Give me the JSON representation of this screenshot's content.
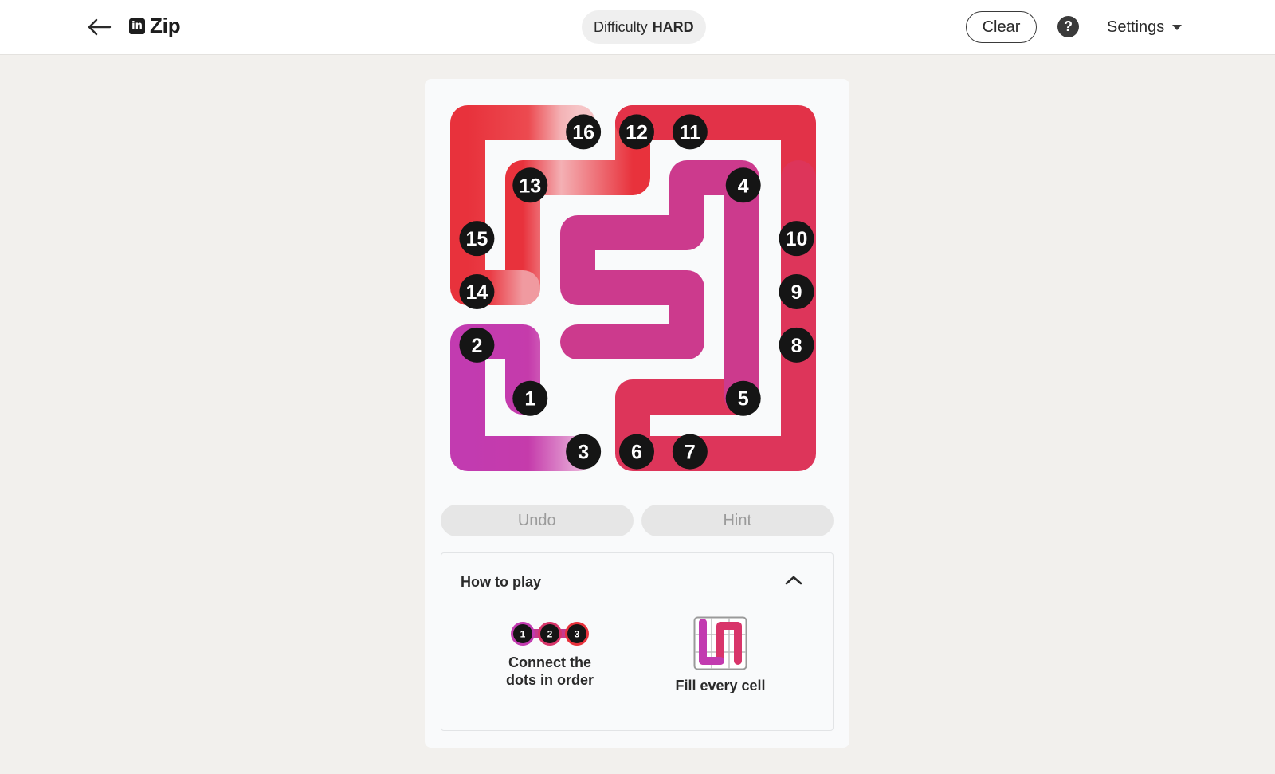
{
  "header": {
    "title": "Zip",
    "logo": "in",
    "difficulty_label": "Difficulty",
    "difficulty_value": "HARD",
    "clear_label": "Clear",
    "help_label": "?",
    "settings_label": "Settings",
    "icons": [
      "back-arrow-icon",
      "linkedin-logo-icon",
      "help-icon",
      "chevron-down-icon"
    ]
  },
  "board": {
    "grid_size": 7,
    "colors": {
      "red": "#e8323c",
      "pink_light": "#f2a8ad",
      "crimson": "#de3559",
      "magenta": "#cf3a84",
      "purple": "#c23bb0",
      "lilac": "#d87fc0",
      "node": "#151515"
    },
    "nodes": [
      {
        "label": "1",
        "row": 5,
        "col": 1
      },
      {
        "label": "2",
        "row": 4,
        "col": 0
      },
      {
        "label": "3",
        "row": 6,
        "col": 2
      },
      {
        "label": "4",
        "row": 1,
        "col": 5
      },
      {
        "label": "5",
        "row": 5,
        "col": 5
      },
      {
        "label": "6",
        "row": 6,
        "col": 3
      },
      {
        "label": "7",
        "row": 6,
        "col": 4
      },
      {
        "label": "8",
        "row": 4,
        "col": 6
      },
      {
        "label": "9",
        "row": 3,
        "col": 6
      },
      {
        "label": "10",
        "row": 2,
        "col": 6
      },
      {
        "label": "11",
        "row": 0,
        "col": 4
      },
      {
        "label": "12",
        "row": 0,
        "col": 3
      },
      {
        "label": "13",
        "row": 1,
        "col": 1
      },
      {
        "label": "14",
        "row": 3,
        "col": 0
      },
      {
        "label": "15",
        "row": 2,
        "col": 0
      },
      {
        "label": "16",
        "row": 0,
        "col": 2
      }
    ]
  },
  "actions": {
    "undo_label": "Undo",
    "hint_label": "Hint"
  },
  "how_to_play": {
    "title": "How to play",
    "tip1_line1": "Connect the",
    "tip1_line2": "dots in order",
    "tip1_dots": [
      "1",
      "2",
      "3"
    ],
    "tip2_label": "Fill every cell"
  }
}
